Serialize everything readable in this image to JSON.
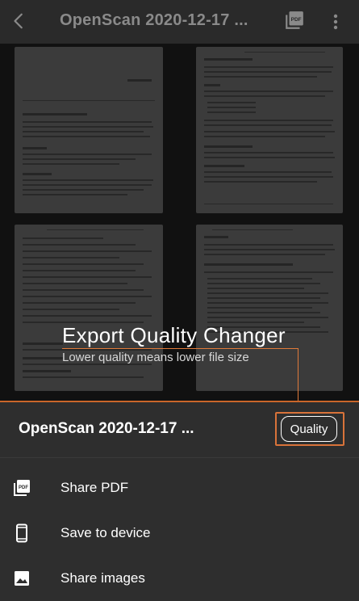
{
  "appbar": {
    "title": "OpenScan 2020-12-17 ...",
    "back_icon": "arrow-back-icon",
    "pdf_icon": "pdf-icon",
    "more_icon": "more-vertical-icon"
  },
  "tutorial": {
    "title": "Export Quality Changer",
    "subtitle": "Lower quality means lower file size",
    "accent_color": "#d9733a"
  },
  "sheet": {
    "title": "OpenScan 2020-12-17 ...",
    "quality_label": "Quality",
    "actions": [
      {
        "label": "Share PDF",
        "icon": "pdf-icon"
      },
      {
        "label": "Save to device",
        "icon": "smartphone-icon"
      },
      {
        "label": "Share images",
        "icon": "image-icon"
      }
    ]
  },
  "colors": {
    "background": "#1e1e1e",
    "sheet": "#2e2e2e",
    "accent": "#d9733a"
  }
}
